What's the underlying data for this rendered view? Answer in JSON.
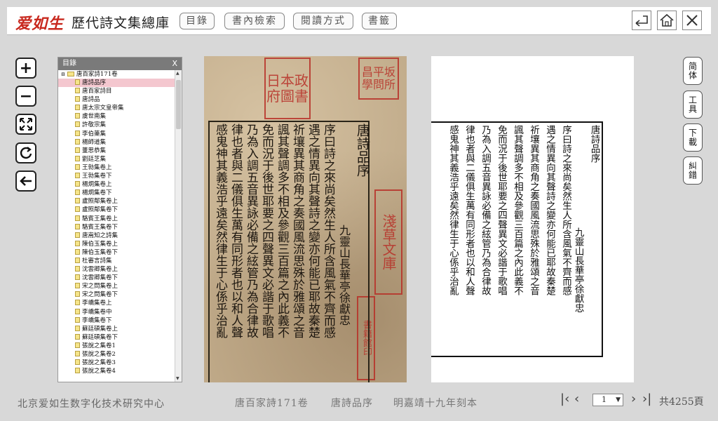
{
  "header": {
    "logo": "爱如生",
    "title": "歷代詩文集總庫",
    "nav": [
      "目錄",
      "書內檢索",
      "閱讀方式",
      "書籤"
    ]
  },
  "toc": {
    "title": "目錄",
    "close": "X",
    "root": "唐百家詩171卷",
    "items": [
      "唐詩品序",
      "唐百家詩目",
      "唐詩品",
      "唐太宗文皇帝集",
      "虞世南集",
      "許敬宗集",
      "李伯藥集",
      "楊師道集",
      "董思恭集",
      "劉廷芝集",
      "王勃集卷上",
      "王勃集卷下",
      "楊炯集卷上",
      "楊炯集卷下",
      "盧照鄰集卷上",
      "盧照鄰集卷下",
      "駱賓王集卷上",
      "駱賓王集卷下",
      "唐嵩知之詩集",
      "陳伯玉集卷上",
      "陳伯玉集卷下",
      "杜審言詩集",
      "沈雲卿集卷上",
      "沈雲卿集卷下",
      "宋之問集卷上",
      "宋之問集卷下",
      "李嶠集卷上",
      "李嶠集卷中",
      "李嶠集卷下",
      "蘇廷碩集卷上",
      "蘇廷碩集卷下",
      "張說之集卷1",
      "張說之集卷2",
      "張說之集卷3",
      "張說之集卷4"
    ],
    "selected_index": 0
  },
  "scan": {
    "title": "唐詩品序",
    "author": "九靈山長華亭徐獻忠",
    "columns": [
      "序曰詩之來尚矣然生人所含風氣不齊而感",
      "遇之情異向其聲詩之變亦何能已耶故秦楚",
      "祈壤異其商角之奏國風流思殊於雅頌之音",
      "諷其聲調多不相及參觀三百篇之內此義不",
      "免而況于後世耶要之四聲異文必諧于歌唱",
      "乃為入調五音異詠必備之絃管乃為合律故",
      "律也者與二儀俱生萬有同形者也以和人聲",
      "感鬼神其義浩乎遠矣然律生于心係乎治亂"
    ],
    "seals": [
      "日本政府圖書",
      "昌平坂學問所",
      "淺草文庫",
      "書籍館印"
    ]
  },
  "transcript": {
    "title": "唐詩品序",
    "author": "九靈山長華亭徐獻忠",
    "columns": [
      "序曰詩之來尚矣然生人所含風氣不齊而感",
      "遇之情異向其聲詩之變亦何能已耶故秦楚",
      "祈壤異其商角之奏國風流思殊於雅頌之音",
      "諷其聲調多不相及參觀三百篇之內此義不",
      "免而況于後世耶要之四聲異文必諧于歌唱",
      "乃為入調五音異詠必備之絃管乃為合律故",
      "律也者與二儀俱生萬有同形者也以和人聲",
      "感鬼神其義浩乎遠矣然律生于心係乎治亂"
    ]
  },
  "side_tools": [
    "简体",
    "工具",
    "下載",
    "糾錯"
  ],
  "footer": {
    "org": "北京爱如生数字化技术研究中心",
    "book": "唐百家詩171卷",
    "chapter": "唐詩品序",
    "edition": "明嘉靖十九年刻本",
    "page": "1",
    "total": "共4255頁"
  },
  "colors": {
    "seal_red": "#c83028",
    "selected_row": "#f4c7cf",
    "panel_header": "#7a7a7a"
  }
}
